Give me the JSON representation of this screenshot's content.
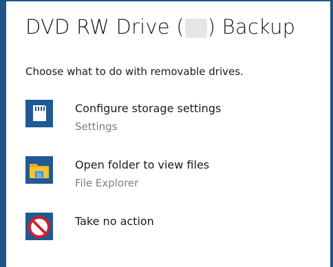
{
  "dialog": {
    "title_prefix": "DVD RW Drive (",
    "title_suffix": ") Backup",
    "prompt": "Choose what to do with removable drives."
  },
  "options": [
    {
      "label": "Configure storage settings",
      "sublabel": "Settings",
      "icon": "sd-card-icon"
    },
    {
      "label": "Open folder to view files",
      "sublabel": "File Explorer",
      "icon": "folder-icon"
    },
    {
      "label": "Take no action",
      "sublabel": "",
      "icon": "no-entry-icon"
    }
  ],
  "colors": {
    "accent": "#20558a",
    "tile": "#1e5a93",
    "secondary_text": "#7d7d7d",
    "no_action_red": "#d0202a",
    "folder_yellow": "#f3c33b"
  }
}
